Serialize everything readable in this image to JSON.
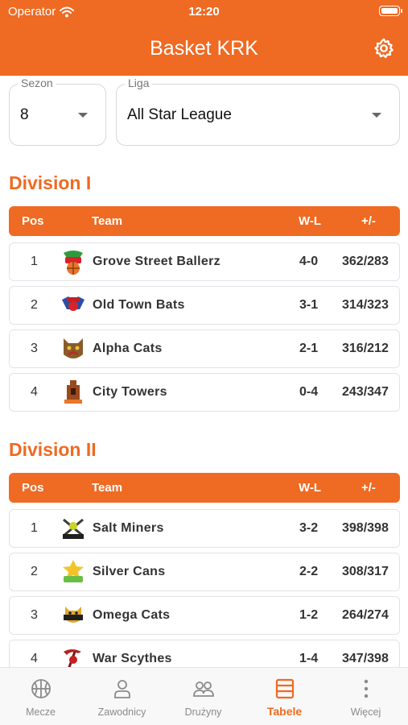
{
  "status_bar": {
    "carrier": "Operator",
    "time": "12:20"
  },
  "header": {
    "title": "Basket KRK"
  },
  "filters": {
    "season": {
      "label": "Sezon",
      "value": "8"
    },
    "league": {
      "label": "Liga",
      "value": "All Star League"
    }
  },
  "table_columns": {
    "pos": "Pos",
    "team": "Team",
    "wl": "W-L",
    "pm": "+/-"
  },
  "divisions": [
    {
      "title": "Division I",
      "rows": [
        {
          "pos": "1",
          "team": "Grove Street Ballerz",
          "wl": "4-0",
          "pm": "362/283"
        },
        {
          "pos": "2",
          "team": "Old Town Bats",
          "wl": "3-1",
          "pm": "314/323"
        },
        {
          "pos": "3",
          "team": "Alpha Cats",
          "wl": "2-1",
          "pm": "316/212"
        },
        {
          "pos": "4",
          "team": "City Towers",
          "wl": "0-4",
          "pm": "243/347"
        }
      ]
    },
    {
      "title": "Division II",
      "rows": [
        {
          "pos": "1",
          "team": "Salt Miners",
          "wl": "3-2",
          "pm": "398/398"
        },
        {
          "pos": "2",
          "team": "Silver Cans",
          "wl": "2-2",
          "pm": "308/317"
        },
        {
          "pos": "3",
          "team": "Omega Cats",
          "wl": "1-2",
          "pm": "264/274"
        },
        {
          "pos": "4",
          "team": "War Scythes",
          "wl": "1-4",
          "pm": "347/398"
        }
      ]
    }
  ],
  "tabs": [
    {
      "label": "Mecze",
      "icon": "basketball-icon"
    },
    {
      "label": "Zawodnicy",
      "icon": "person-icon"
    },
    {
      "label": "Drużyny",
      "icon": "people-icon"
    },
    {
      "label": "Tabele",
      "icon": "table-icon",
      "active": true
    },
    {
      "label": "Więcej",
      "icon": "more-vertical-icon"
    }
  ],
  "colors": {
    "accent": "#ef6a22",
    "tab_inactive": "#8a8a8a"
  }
}
